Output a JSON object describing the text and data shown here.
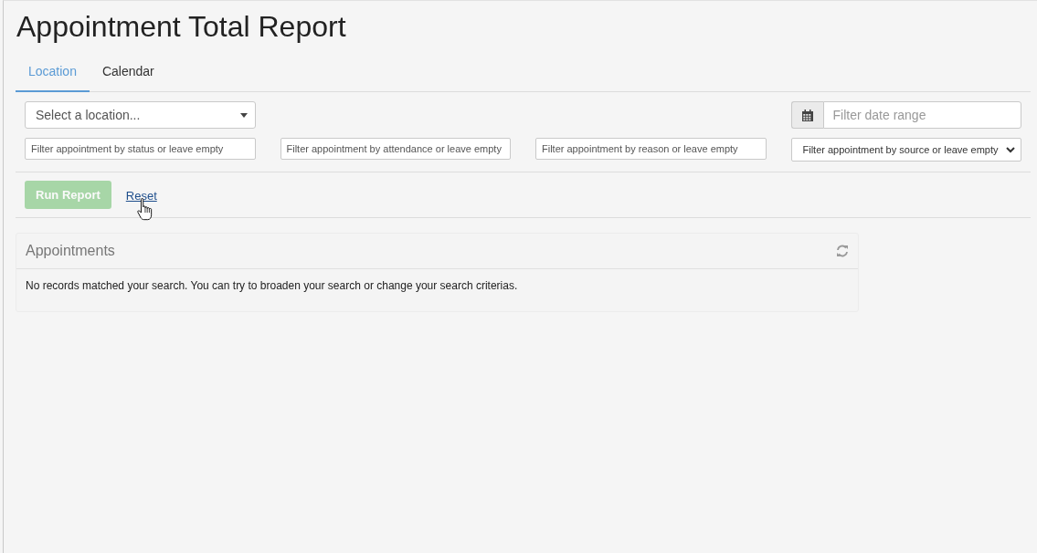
{
  "page_title": "Appointment Total Report",
  "tabs": [
    {
      "label": "Location",
      "selected": true
    },
    {
      "label": "Calendar",
      "selected": false
    }
  ],
  "location_select": {
    "placeholder": "Select a location..."
  },
  "date_range": {
    "placeholder": "Filter date range"
  },
  "filters": [
    {
      "kind": "text",
      "placeholder": "Filter appointment by status or leave empty"
    },
    {
      "kind": "text",
      "placeholder": "Filter appointment by attendance or leave empty"
    },
    {
      "kind": "text",
      "placeholder": "Filter appointment by reason or leave empty"
    },
    {
      "kind": "select",
      "value": "Filter appointment by source or leave empty"
    }
  ],
  "run_button": {
    "label": "Run Report",
    "disabled": true
  },
  "reset_link": {
    "label": "Reset"
  },
  "panel": {
    "title": "Appointments",
    "message": "No records matched your search. You can try to broaden your search or change your search criterias."
  }
}
